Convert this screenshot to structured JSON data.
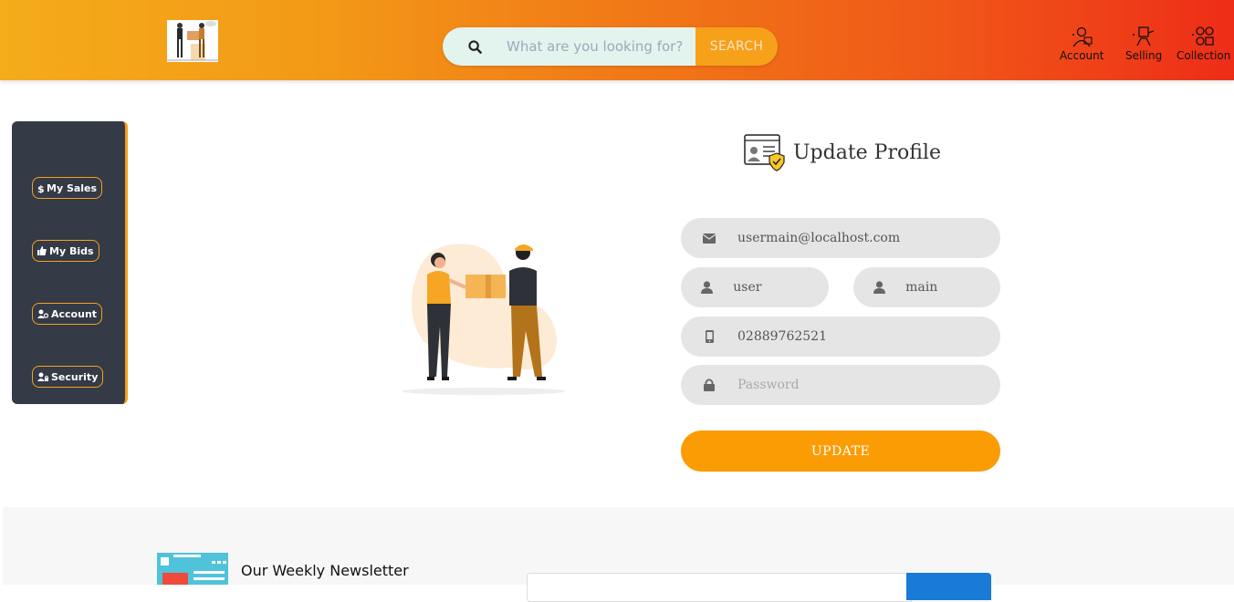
{
  "header": {
    "search": {
      "placeholder": "What are you looking for?",
      "button_label": "SEARCH"
    },
    "nav": [
      {
        "label": "Account",
        "icon": "account-icon"
      },
      {
        "label": "Selling",
        "icon": "selling-icon"
      },
      {
        "label": "Collection",
        "icon": "collection-icon"
      }
    ]
  },
  "sidebar": {
    "items": [
      {
        "label": "My Sales",
        "icon": "dollar-icon"
      },
      {
        "label": "My Bids",
        "icon": "thumbs-up-icon"
      },
      {
        "label": "Account",
        "icon": "user-gear-icon"
      },
      {
        "label": "Security",
        "icon": "user-lock-icon"
      }
    ]
  },
  "form": {
    "title": "Update Profile",
    "email": {
      "value": "usermain@localhost.com",
      "icon": "envelope-icon"
    },
    "first_name": {
      "value": "user",
      "icon": "user-icon"
    },
    "last_name": {
      "value": "main",
      "icon": "user-icon"
    },
    "phone": {
      "value": "02889762521",
      "icon": "mobile-icon"
    },
    "password": {
      "value": "",
      "placeholder": "Password",
      "icon": "lock-icon"
    },
    "submit_label": "UPDATE"
  },
  "newsletter": {
    "title": "Our Weekly Newsletter"
  },
  "colors": {
    "accent": "#fb9c05",
    "sidebar_bg": "#343a46",
    "header_start": "#f4ac1a",
    "header_end": "#ee2d18"
  }
}
